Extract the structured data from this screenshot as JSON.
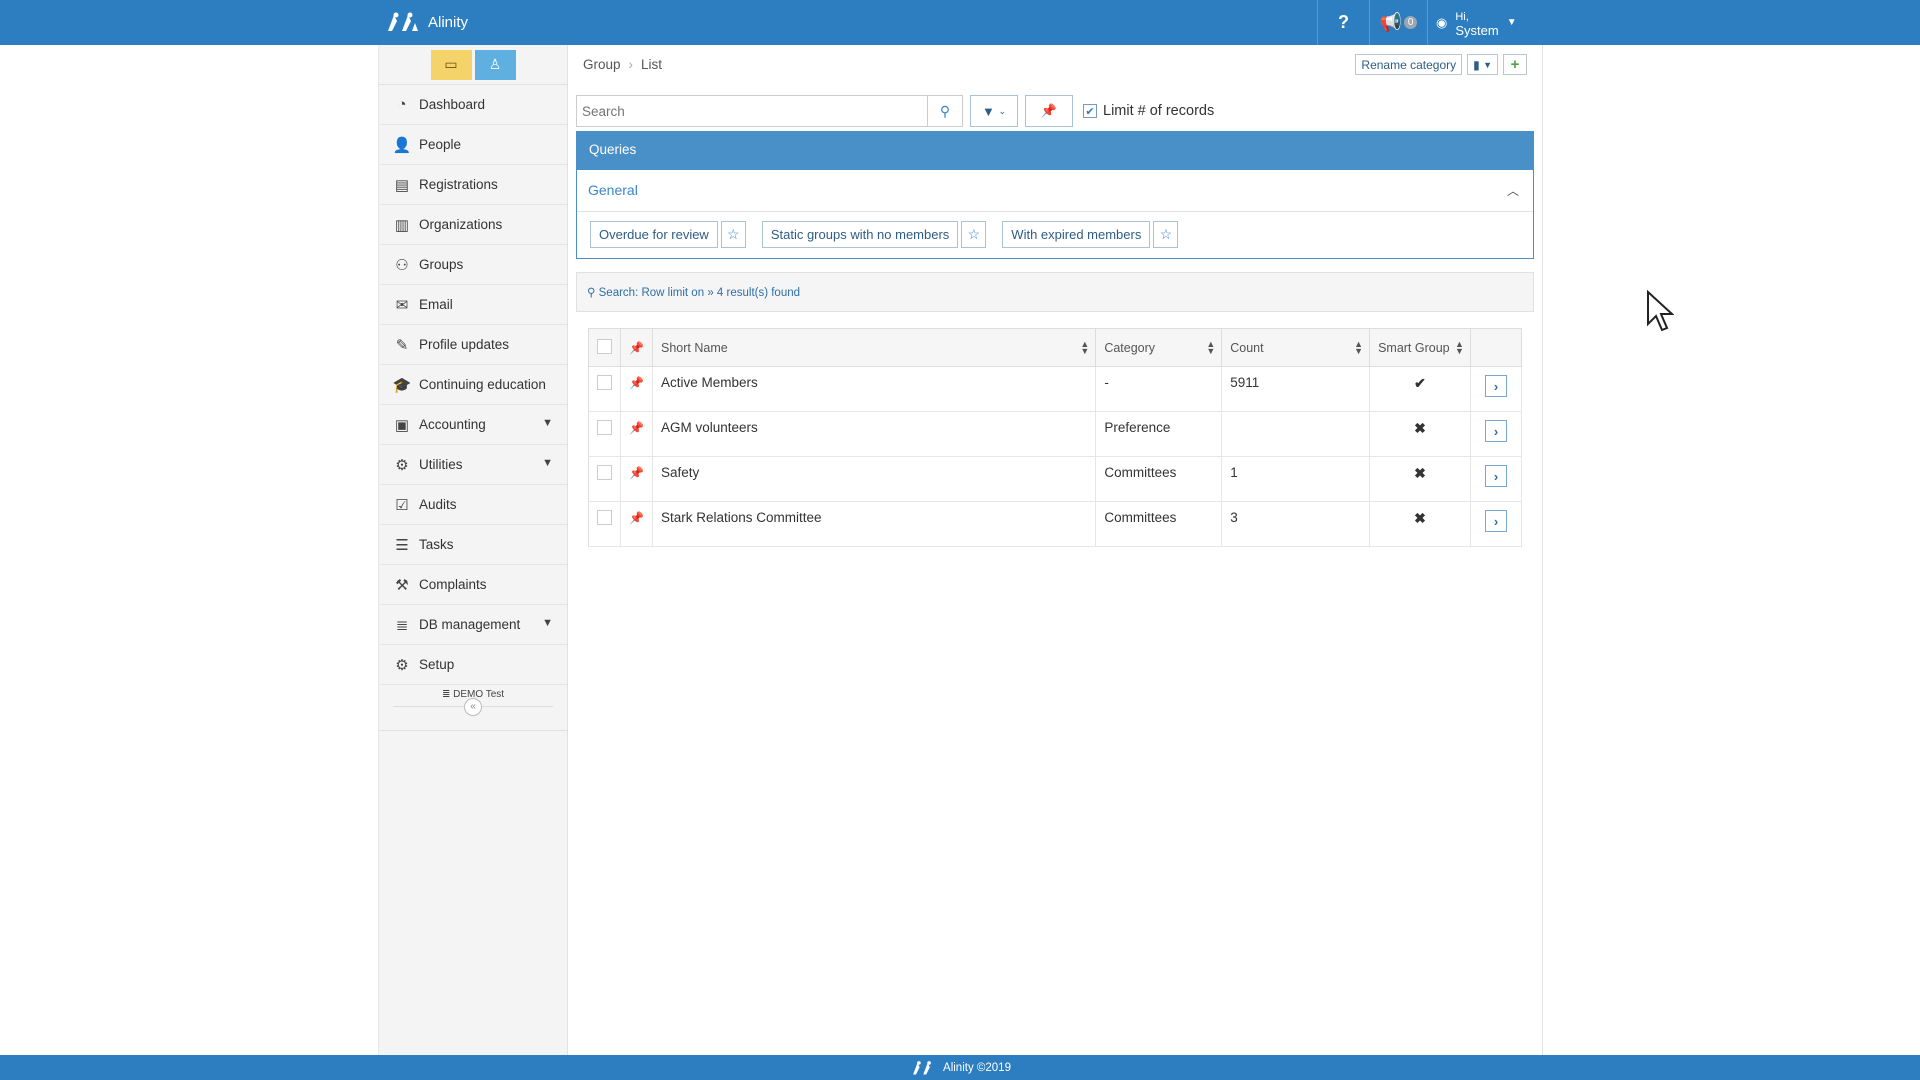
{
  "app": {
    "name": "Alinity",
    "footer": "Alinity ©2019"
  },
  "topbar": {
    "help_label": "?",
    "notifications_count": "0",
    "user_greeting": "Hi,",
    "user_name": "System"
  },
  "sidebar": {
    "items": [
      {
        "label": "Dashboard",
        "icon": "dashboard-icon",
        "glyph": "◔"
      },
      {
        "label": "People",
        "icon": "person-icon",
        "glyph": "👤"
      },
      {
        "label": "Registrations",
        "icon": "id-card-icon",
        "glyph": "▤"
      },
      {
        "label": "Organizations",
        "icon": "building-icon",
        "glyph": "▥"
      },
      {
        "label": "Groups",
        "icon": "users-icon",
        "glyph": "⚇"
      },
      {
        "label": "Email",
        "icon": "envelope-icon",
        "glyph": "✉"
      },
      {
        "label": "Profile updates",
        "icon": "edit-icon",
        "glyph": "✎"
      },
      {
        "label": "Continuing education",
        "icon": "graduation-cap-icon",
        "glyph": "🎓"
      },
      {
        "label": "Accounting",
        "icon": "money-icon",
        "glyph": "▣"
      },
      {
        "label": "Utilities",
        "icon": "cogs-icon",
        "glyph": "⚙"
      },
      {
        "label": "Audits",
        "icon": "check-square-icon",
        "glyph": "☑"
      },
      {
        "label": "Tasks",
        "icon": "tasks-icon",
        "glyph": "☰"
      },
      {
        "label": "Complaints",
        "icon": "gavel-icon",
        "glyph": "⚒"
      },
      {
        "label": "DB management",
        "icon": "database-icon",
        "glyph": "≣"
      },
      {
        "label": "Setup",
        "icon": "gear-icon",
        "glyph": "⚙"
      }
    ],
    "env_label": "DEMO Test"
  },
  "breadcrumb": {
    "level1": "Group",
    "level2": "List"
  },
  "header_actions": {
    "rename_label": "Rename category"
  },
  "search": {
    "placeholder": "Search",
    "limit_label": "Limit # of records",
    "limit_checked": true
  },
  "queries": {
    "title": "Queries",
    "section": "General",
    "buttons": [
      "Overdue for review",
      "Static groups with no members",
      "With expired members"
    ]
  },
  "status": {
    "text": "Search: Row limit on",
    "results": "4 result(s) found"
  },
  "table": {
    "columns": [
      "Short Name",
      "Category",
      "Count",
      "Smart Group"
    ],
    "rows": [
      {
        "name": "Active Members",
        "category": "-",
        "count": "5911",
        "smart": "check"
      },
      {
        "name": "AGM volunteers",
        "category": "Preference",
        "count": "",
        "smart": "cross"
      },
      {
        "name": "Safety",
        "category": "Committees",
        "count": "1",
        "smart": "cross"
      },
      {
        "name": "Stark Relations Committee",
        "category": "Committees",
        "count": "3",
        "smart": "cross"
      }
    ]
  },
  "colors": {
    "primary": "#2d7ec0",
    "queries_header": "#4a90c8"
  }
}
